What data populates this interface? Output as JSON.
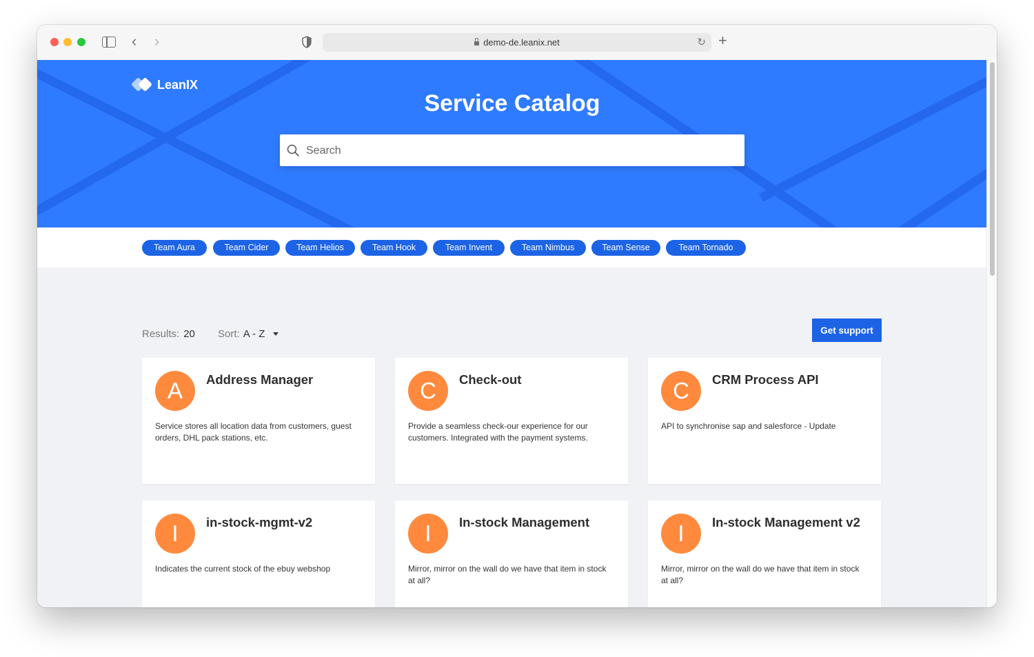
{
  "browser": {
    "url": "demo-de.leanix.net"
  },
  "header": {
    "logo_text": "LeanIX",
    "title": "Service Catalog",
    "search_placeholder": "Search"
  },
  "teams": [
    "Team Aura",
    "Team Cider",
    "Team Helios",
    "Team Hook",
    "Team Invent",
    "Team Nimbus",
    "Team Sense",
    "Team Tornado"
  ],
  "results": {
    "label": "Results:",
    "count": "20",
    "sort_label": "Sort:",
    "sort_value": "A - Z",
    "support_label": "Get support"
  },
  "services": [
    {
      "initial": "A",
      "name": "Address Manager",
      "description": "Service stores all location data from customers, guest orders, DHL pack stations, etc."
    },
    {
      "initial": "C",
      "name": "Check-out",
      "description": "Provide a seamless check-our experience for our customers. Integrated with the payment systems."
    },
    {
      "initial": "C",
      "name": "CRM Process API",
      "description": "API to synchronise sap and salesforce - Update"
    },
    {
      "initial": "I",
      "name": "in-stock-mgmt-v2",
      "description": "Indicates the current stock of the ebuy webshop"
    },
    {
      "initial": "I",
      "name": "In-stock Management",
      "description": "Mirror, mirror on the wall do we have that item in stock at all?"
    },
    {
      "initial": "I",
      "name": "In-stock Management v2",
      "description": "Mirror, mirror on the wall do we have that item in stock at all?"
    }
  ],
  "colors": {
    "hero_blue": "#2f7bff",
    "chip_blue": "#1c63e6",
    "avatar_orange": "#ff8a3d"
  }
}
